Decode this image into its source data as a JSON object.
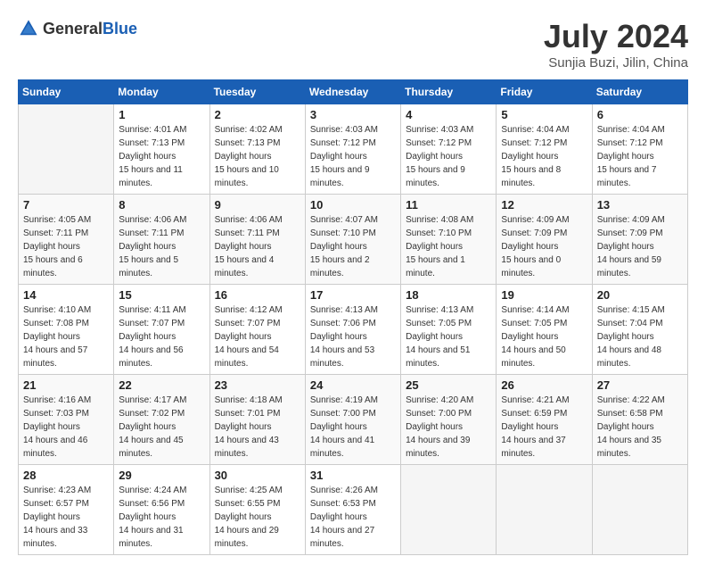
{
  "header": {
    "logo_general": "General",
    "logo_blue": "Blue",
    "title": "July 2024",
    "location": "Sunjia Buzi, Jilin, China"
  },
  "days_of_week": [
    "Sunday",
    "Monday",
    "Tuesday",
    "Wednesday",
    "Thursday",
    "Friday",
    "Saturday"
  ],
  "weeks": [
    [
      {
        "day": "",
        "empty": true
      },
      {
        "day": "1",
        "sunrise": "4:01 AM",
        "sunset": "7:13 PM",
        "daylight": "15 hours and 11 minutes."
      },
      {
        "day": "2",
        "sunrise": "4:02 AM",
        "sunset": "7:13 PM",
        "daylight": "15 hours and 10 minutes."
      },
      {
        "day": "3",
        "sunrise": "4:03 AM",
        "sunset": "7:12 PM",
        "daylight": "15 hours and 9 minutes."
      },
      {
        "day": "4",
        "sunrise": "4:03 AM",
        "sunset": "7:12 PM",
        "daylight": "15 hours and 9 minutes."
      },
      {
        "day": "5",
        "sunrise": "4:04 AM",
        "sunset": "7:12 PM",
        "daylight": "15 hours and 8 minutes."
      },
      {
        "day": "6",
        "sunrise": "4:04 AM",
        "sunset": "7:12 PM",
        "daylight": "15 hours and 7 minutes."
      }
    ],
    [
      {
        "day": "7",
        "sunrise": "4:05 AM",
        "sunset": "7:11 PM",
        "daylight": "15 hours and 6 minutes."
      },
      {
        "day": "8",
        "sunrise": "4:06 AM",
        "sunset": "7:11 PM",
        "daylight": "15 hours and 5 minutes."
      },
      {
        "day": "9",
        "sunrise": "4:06 AM",
        "sunset": "7:11 PM",
        "daylight": "15 hours and 4 minutes."
      },
      {
        "day": "10",
        "sunrise": "4:07 AM",
        "sunset": "7:10 PM",
        "daylight": "15 hours and 2 minutes."
      },
      {
        "day": "11",
        "sunrise": "4:08 AM",
        "sunset": "7:10 PM",
        "daylight": "15 hours and 1 minute."
      },
      {
        "day": "12",
        "sunrise": "4:09 AM",
        "sunset": "7:09 PM",
        "daylight": "15 hours and 0 minutes."
      },
      {
        "day": "13",
        "sunrise": "4:09 AM",
        "sunset": "7:09 PM",
        "daylight": "14 hours and 59 minutes."
      }
    ],
    [
      {
        "day": "14",
        "sunrise": "4:10 AM",
        "sunset": "7:08 PM",
        "daylight": "14 hours and 57 minutes."
      },
      {
        "day": "15",
        "sunrise": "4:11 AM",
        "sunset": "7:07 PM",
        "daylight": "14 hours and 56 minutes."
      },
      {
        "day": "16",
        "sunrise": "4:12 AM",
        "sunset": "7:07 PM",
        "daylight": "14 hours and 54 minutes."
      },
      {
        "day": "17",
        "sunrise": "4:13 AM",
        "sunset": "7:06 PM",
        "daylight": "14 hours and 53 minutes."
      },
      {
        "day": "18",
        "sunrise": "4:13 AM",
        "sunset": "7:05 PM",
        "daylight": "14 hours and 51 minutes."
      },
      {
        "day": "19",
        "sunrise": "4:14 AM",
        "sunset": "7:05 PM",
        "daylight": "14 hours and 50 minutes."
      },
      {
        "day": "20",
        "sunrise": "4:15 AM",
        "sunset": "7:04 PM",
        "daylight": "14 hours and 48 minutes."
      }
    ],
    [
      {
        "day": "21",
        "sunrise": "4:16 AM",
        "sunset": "7:03 PM",
        "daylight": "14 hours and 46 minutes."
      },
      {
        "day": "22",
        "sunrise": "4:17 AM",
        "sunset": "7:02 PM",
        "daylight": "14 hours and 45 minutes."
      },
      {
        "day": "23",
        "sunrise": "4:18 AM",
        "sunset": "7:01 PM",
        "daylight": "14 hours and 43 minutes."
      },
      {
        "day": "24",
        "sunrise": "4:19 AM",
        "sunset": "7:00 PM",
        "daylight": "14 hours and 41 minutes."
      },
      {
        "day": "25",
        "sunrise": "4:20 AM",
        "sunset": "7:00 PM",
        "daylight": "14 hours and 39 minutes."
      },
      {
        "day": "26",
        "sunrise": "4:21 AM",
        "sunset": "6:59 PM",
        "daylight": "14 hours and 37 minutes."
      },
      {
        "day": "27",
        "sunrise": "4:22 AM",
        "sunset": "6:58 PM",
        "daylight": "14 hours and 35 minutes."
      }
    ],
    [
      {
        "day": "28",
        "sunrise": "4:23 AM",
        "sunset": "6:57 PM",
        "daylight": "14 hours and 33 minutes."
      },
      {
        "day": "29",
        "sunrise": "4:24 AM",
        "sunset": "6:56 PM",
        "daylight": "14 hours and 31 minutes."
      },
      {
        "day": "30",
        "sunrise": "4:25 AM",
        "sunset": "6:55 PM",
        "daylight": "14 hours and 29 minutes."
      },
      {
        "day": "31",
        "sunrise": "4:26 AM",
        "sunset": "6:53 PM",
        "daylight": "14 hours and 27 minutes."
      },
      {
        "day": "",
        "empty": true
      },
      {
        "day": "",
        "empty": true
      },
      {
        "day": "",
        "empty": true
      }
    ]
  ],
  "labels": {
    "sunrise": "Sunrise:",
    "sunset": "Sunset:",
    "daylight": "Daylight hours"
  }
}
